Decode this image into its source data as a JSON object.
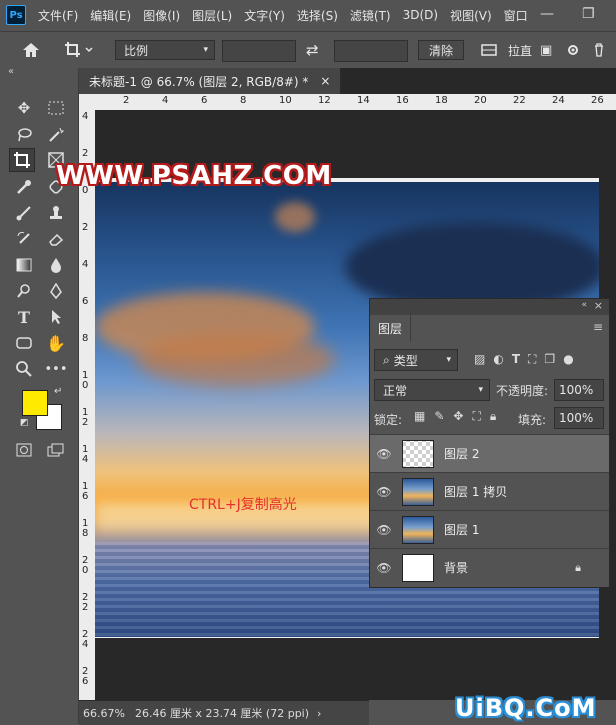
{
  "app": {
    "logo_text": "Ps"
  },
  "menu": [
    "文件(F)",
    "编辑(E)",
    "图像(I)",
    "图层(L)",
    "文字(Y)",
    "选择(S)",
    "滤镜(T)",
    "3D(D)",
    "视图(V)",
    "窗口"
  ],
  "window_controls": {
    "minimize": "—",
    "restore": "❐"
  },
  "options_bar": {
    "ratio_select": "比例",
    "swap_icon": "⇄",
    "clear_button": "清除",
    "straighten_label": "拉直",
    "more_icon": "▣"
  },
  "document_tab": {
    "title": "未标题-1 @ 66.7% (图层 2, RGB/8#) *",
    "close": "×"
  },
  "ruler_top_ticks": [
    "2",
    "4",
    "6",
    "8",
    "10",
    "12",
    "14",
    "16",
    "18",
    "20",
    "22",
    "24",
    "26"
  ],
  "ruler_left_ticks": [
    "4",
    "2",
    "0",
    "2",
    "4",
    "6",
    "8",
    "1 0",
    "1 2",
    "1 4",
    "1 6",
    "1 8",
    "2 0",
    "2 2",
    "2 4",
    "2 6"
  ],
  "status_bar": {
    "zoom": "66.67%",
    "doc_info": "26.46 厘米 x 23.74 厘米 (72 ppi)",
    "arrow": "›"
  },
  "annotation": "CTRL+J复制高光",
  "watermarks": {
    "top": "WWW.PSAHZ.COM",
    "bottom": "UiBQ.CoM"
  },
  "colors": {
    "foreground": "#ffea00",
    "background": "#ffffff",
    "accent_red": "#e8302a"
  },
  "layers_panel": {
    "tab": "图层",
    "filter_label": "类型",
    "blend_mode": "正常",
    "opacity_label": "不透明度:",
    "opacity_value": "100%",
    "lock_label": "锁定:",
    "fill_label": "填充:",
    "fill_value": "100%",
    "layers": [
      {
        "name": "图层 2",
        "selected": true,
        "thumb": "transparent"
      },
      {
        "name": "图层 1 拷贝",
        "selected": false,
        "thumb": "sky"
      },
      {
        "name": "图层 1",
        "selected": false,
        "thumb": "sky"
      },
      {
        "name": "背景",
        "selected": false,
        "thumb": "white",
        "locked": true
      }
    ]
  }
}
